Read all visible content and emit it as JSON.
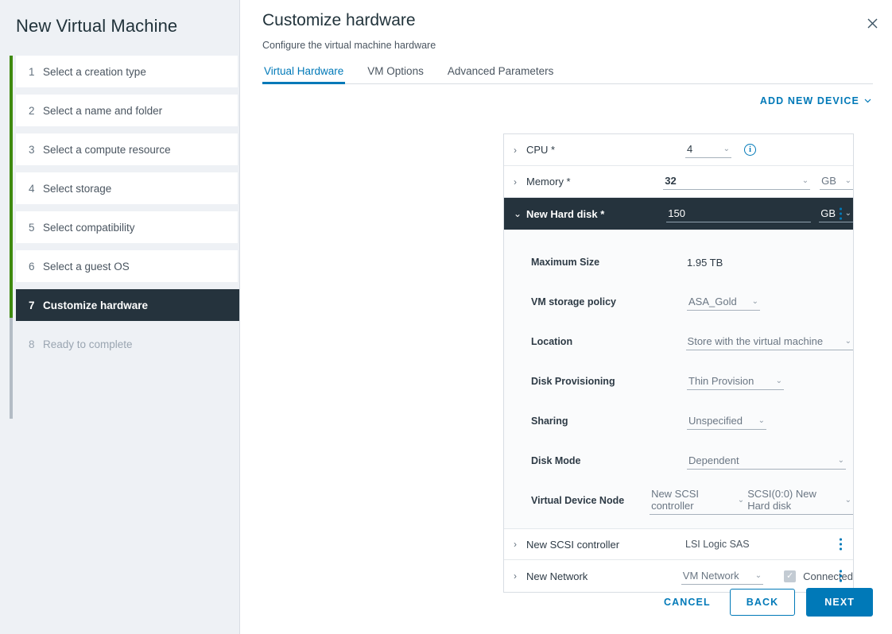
{
  "wizard": {
    "title": "New Virtual Machine",
    "steps": [
      {
        "num": "1",
        "label": "Select a creation type",
        "state": "done"
      },
      {
        "num": "2",
        "label": "Select a name and folder",
        "state": "done"
      },
      {
        "num": "3",
        "label": "Select a compute resource",
        "state": "done"
      },
      {
        "num": "4",
        "label": "Select storage",
        "state": "done"
      },
      {
        "num": "5",
        "label": "Select compatibility",
        "state": "done"
      },
      {
        "num": "6",
        "label": "Select a guest OS",
        "state": "done"
      },
      {
        "num": "7",
        "label": "Customize hardware",
        "state": "active"
      },
      {
        "num": "8",
        "label": "Ready to complete",
        "state": "disabled"
      }
    ]
  },
  "header": {
    "title": "Customize hardware",
    "subtitle": "Configure the virtual machine hardware",
    "close_icon": "close-icon"
  },
  "tabs": [
    {
      "label": "Virtual Hardware",
      "active": true
    },
    {
      "label": "VM Options",
      "active": false
    },
    {
      "label": "Advanced Parameters",
      "active": false
    }
  ],
  "toolbar": {
    "add_new_device_label": "ADD NEW DEVICE",
    "add_new_device_icon": "chevron-down-icon"
  },
  "devices": {
    "cpu": {
      "caret": "›",
      "label": "CPU *",
      "value": "4",
      "chevron": "⌄",
      "info_icon": "info-icon",
      "info_glyph": "i"
    },
    "memory": {
      "caret": "›",
      "label": "Memory *",
      "value": "32",
      "chevron": "⌄",
      "unit": "GB",
      "unit_chevron": "⌄"
    },
    "hard_disk": {
      "caret": "⌄",
      "label": "New Hard disk *",
      "value": "150",
      "unit": "GB",
      "unit_chevron": "⌄",
      "kebab_icon": "kebab-menu-icon"
    },
    "scsi_controller": {
      "caret": "›",
      "label": "New SCSI controller",
      "value": "LSI Logic SAS",
      "kebab_icon": "kebab-menu-icon"
    },
    "network": {
      "caret": "›",
      "label": "New Network",
      "value": "VM Network",
      "chevron": "⌄",
      "connected_label": "Connected",
      "connected_checked": true,
      "check_glyph": "✓",
      "kebab_icon": "kebab-menu-icon"
    }
  },
  "disk_detail": {
    "maximum_size": {
      "label": "Maximum Size",
      "value": "1.95 TB"
    },
    "vm_storage_policy": {
      "label": "VM storage policy",
      "value": "ASA_Gold",
      "chevron": "⌄"
    },
    "location": {
      "label": "Location",
      "value": "Store with the virtual machine",
      "chevron": "⌄"
    },
    "disk_provisioning": {
      "label": "Disk Provisioning",
      "value": "Thin Provision",
      "chevron": "⌄"
    },
    "sharing": {
      "label": "Sharing",
      "value": "Unspecified",
      "chevron": "⌄"
    },
    "disk_mode": {
      "label": "Disk Mode",
      "value": "Dependent",
      "chevron": "⌄"
    },
    "virtual_device_node": {
      "label": "Virtual Device Node",
      "controller": "New SCSI controller",
      "controller_chevron": "⌄",
      "node": "SCSI(0:0) New Hard disk",
      "node_chevron": "⌄"
    }
  },
  "footer": {
    "cancel": "CANCEL",
    "back": "BACK",
    "next": "NEXT"
  },
  "colors": {
    "accent_blue": "#0079b8",
    "rail_green": "#3f8a0f",
    "rail_gray": "#b3bcc5",
    "dark_row": "#25333d",
    "sidebar_bg": "#eef1f5"
  }
}
